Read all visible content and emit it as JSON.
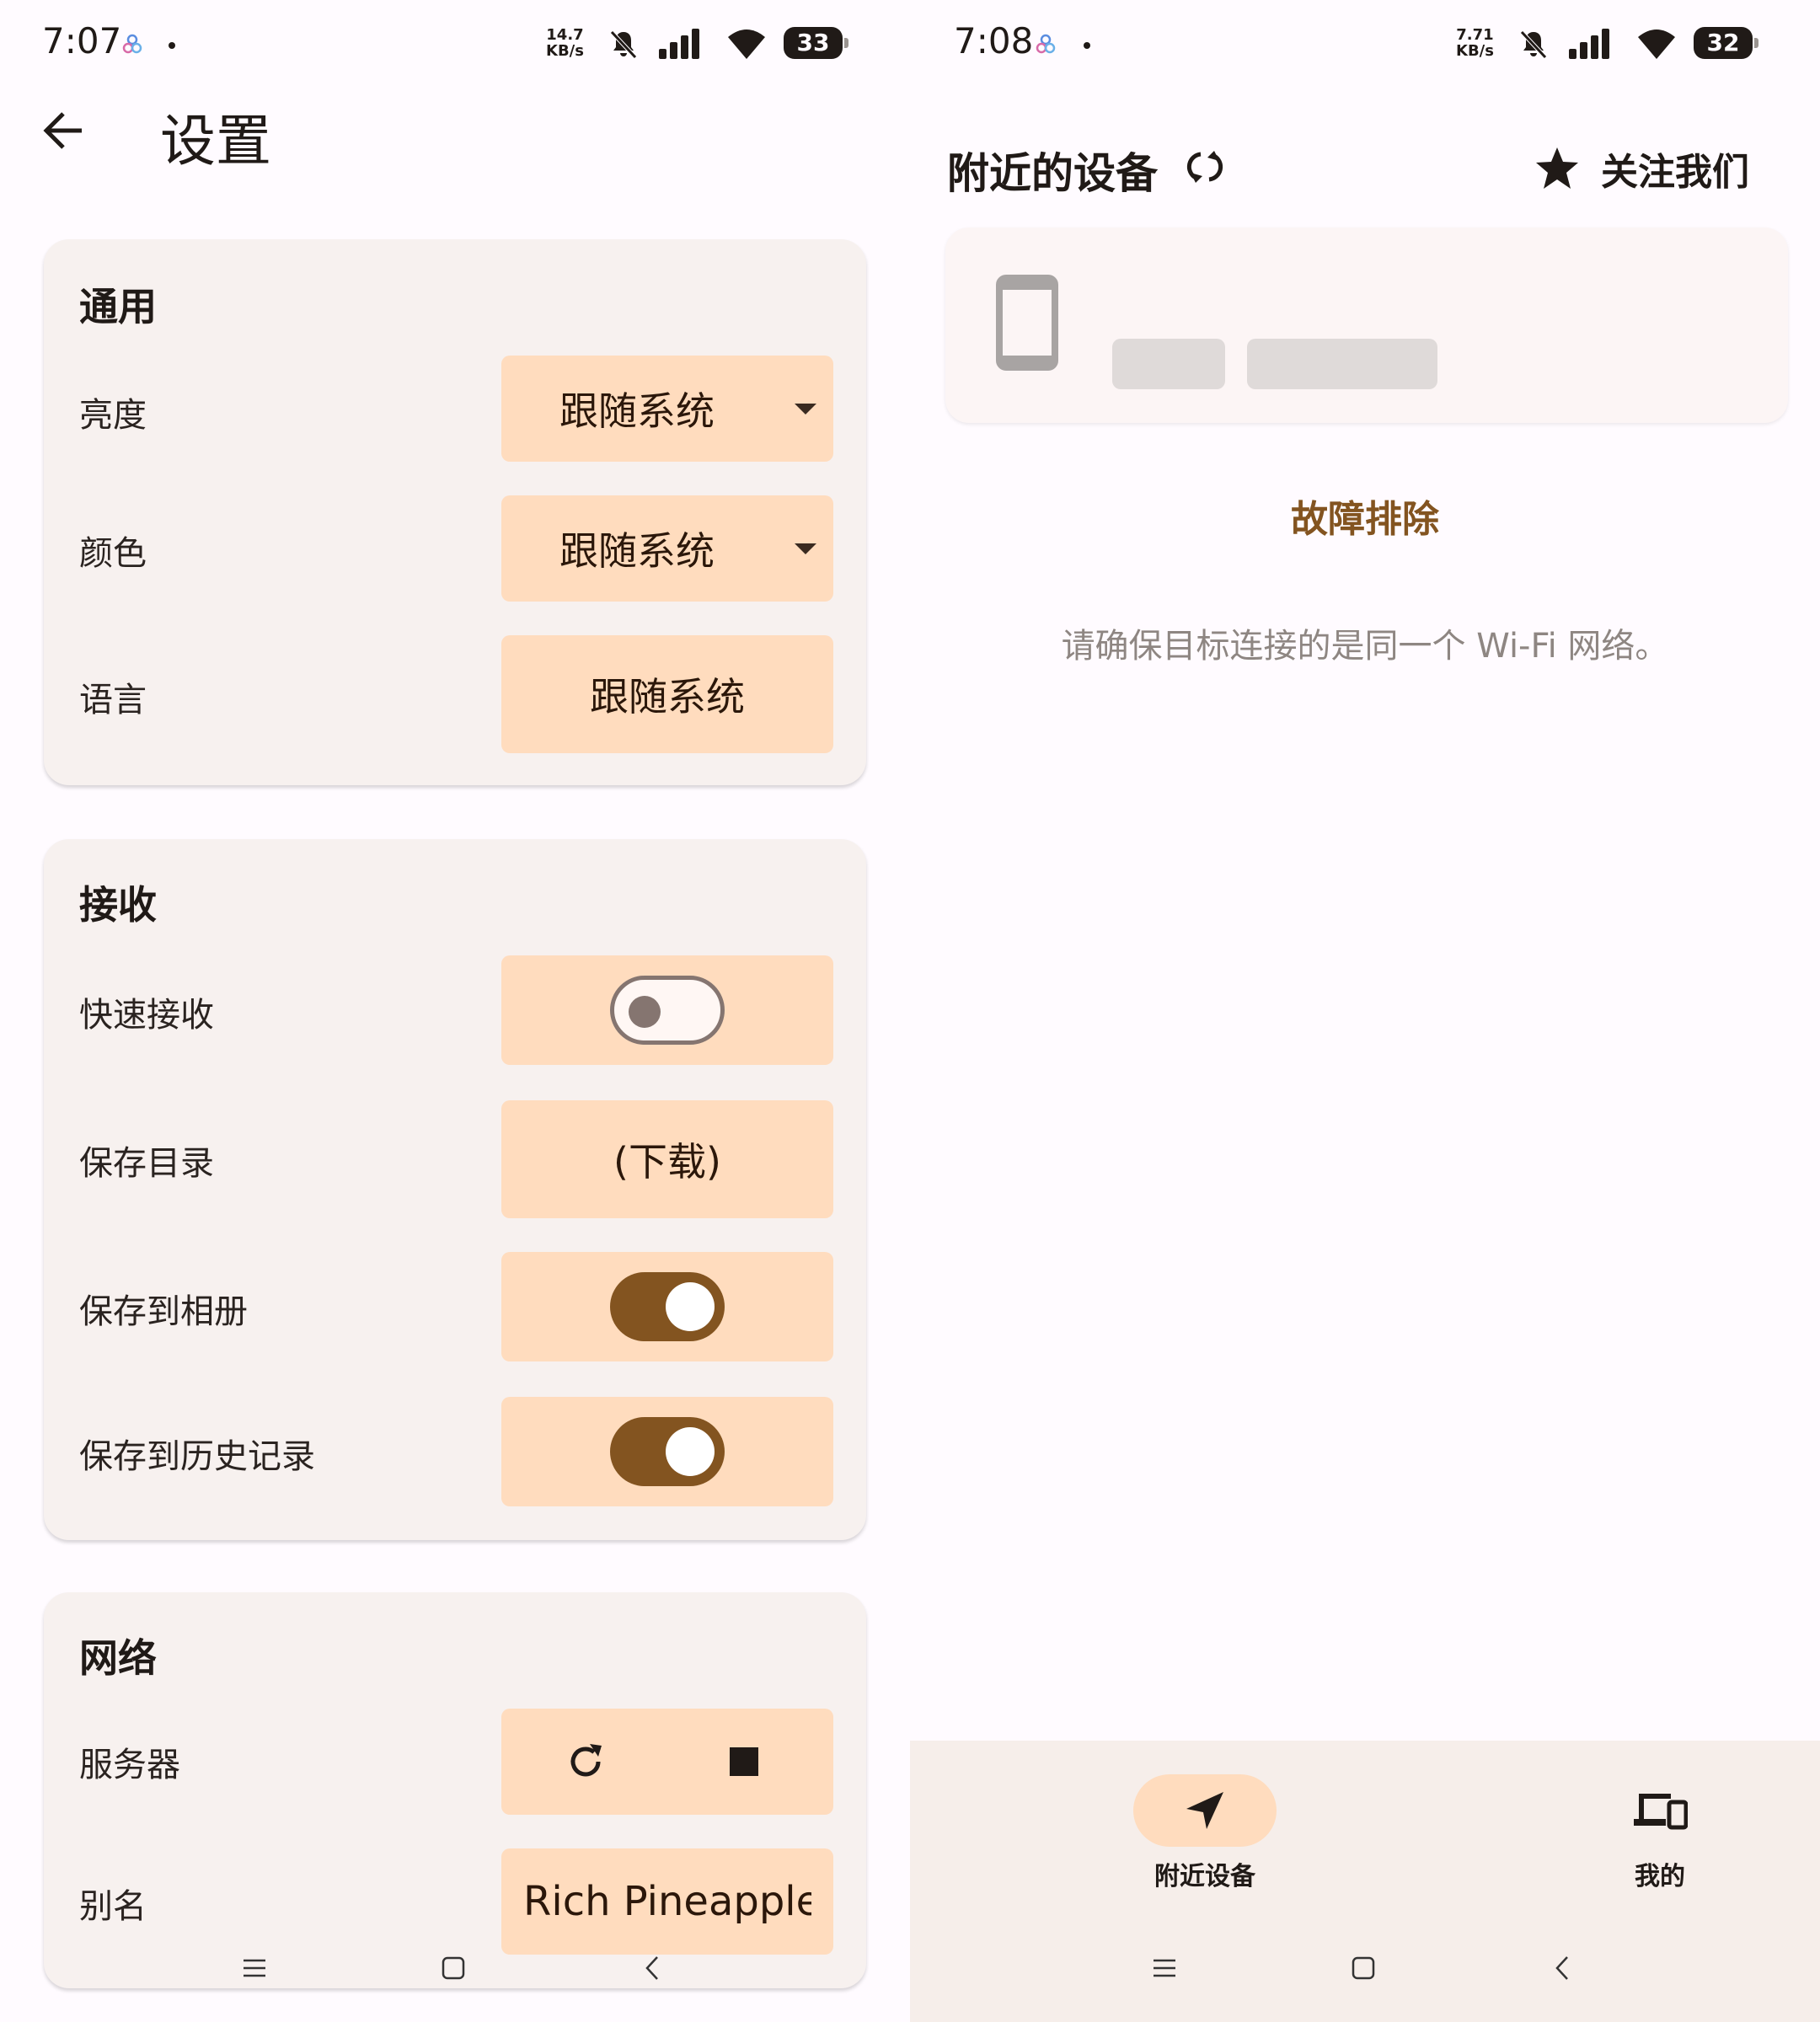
{
  "left": {
    "status": {
      "time": "7:07",
      "net_speed_top": "14.7",
      "net_speed_bottom": "KB/s",
      "battery": "33"
    },
    "title": "设置",
    "sections": {
      "general": {
        "title": "通用",
        "brightness_label": "亮度",
        "brightness_value": "跟随系统",
        "color_label": "颜色",
        "color_value": "跟随系统",
        "language_label": "语言",
        "language_value": "跟随系统"
      },
      "receive": {
        "title": "接收",
        "quick_receive_label": "快速接收",
        "quick_receive_on": false,
        "save_dir_label": "保存目录",
        "save_dir_value": "(下载)",
        "save_album_label": "保存到相册",
        "save_album_on": true,
        "save_history_label": "保存到历史记录",
        "save_history_on": true
      },
      "network": {
        "title": "网络",
        "server_label": "服务器",
        "alias_label": "别名",
        "alias_value": "Rich Pineapple"
      }
    }
  },
  "right": {
    "status": {
      "time": "7:08",
      "net_speed_top": "7.71",
      "net_speed_bottom": "KB/s",
      "battery": "32"
    },
    "title": "附近的设备",
    "follow_label": "关注我们",
    "troubleshoot_label": "故障排除",
    "hint": "请确保目标连接的是同一个 Wi-Fi 网络。",
    "bottom_nav": {
      "nearby_label": "附近设备",
      "mine_label": "我的"
    }
  },
  "colors": {
    "accent": "#835420",
    "control_bg": "#ffdcbe",
    "card_bg": "#f7f1ef"
  }
}
